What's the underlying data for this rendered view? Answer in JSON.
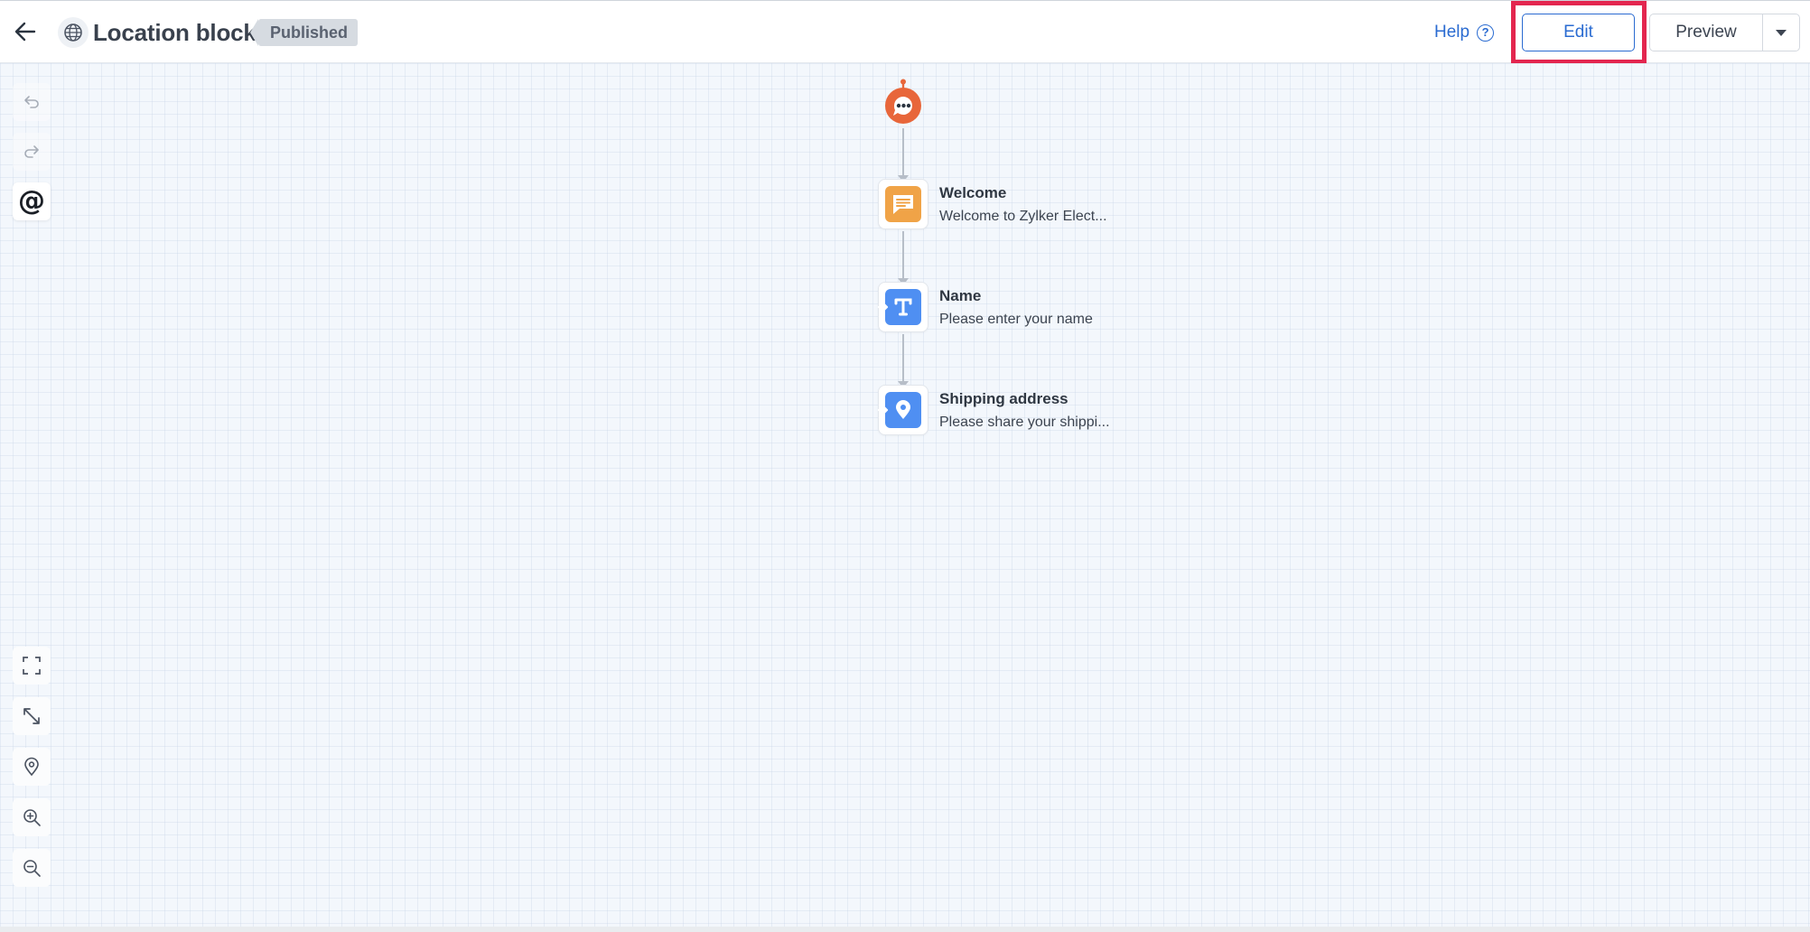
{
  "header": {
    "title": "Location block",
    "status": "Published",
    "help_label": "Help",
    "help_icon": "?",
    "edit_label": "Edit",
    "preview_label": "Preview"
  },
  "toolbar_left": {
    "mention_symbol": "@"
  },
  "flow": {
    "nodes": [
      {
        "title": "Welcome",
        "subtitle": "Welcome to Zylker Elect...",
        "icon": "message-icon",
        "color": "#f0a347"
      },
      {
        "title": "Name",
        "subtitle": "Please enter your name",
        "icon": "text-input-icon",
        "color": "#4f8ff2"
      },
      {
        "title": "Shipping address",
        "subtitle": "Please share your shippi...",
        "icon": "location-pin-icon",
        "color": "#4f8ff2"
      }
    ]
  },
  "colors": {
    "accent": "#2a6bd1",
    "highlight": "#e3264f",
    "bot": "#e8663a"
  }
}
